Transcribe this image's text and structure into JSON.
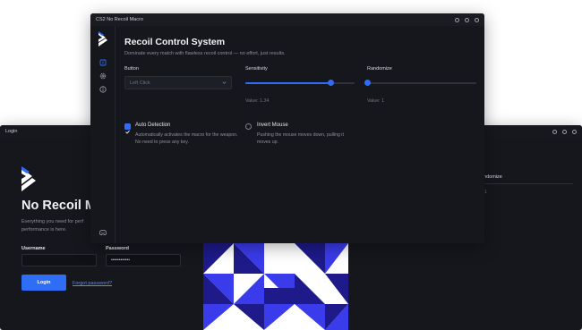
{
  "login_window": {
    "title": "Login",
    "heading": "No Recoil M",
    "subtitle": "Everything you need for perf... performance is here.",
    "subtitle_line1": "Everything you need for perf",
    "subtitle_line2": "performance is here.",
    "username_label": "Username",
    "username_value": "",
    "password_label": "Password",
    "password_value": "••••••••••••",
    "login_button": "Login",
    "forgot_link": "Forgot password?",
    "ghost_label": "andomize",
    "ghost_value": "e 1"
  },
  "main_window": {
    "title": "CS2 No Recoil Macro",
    "heading": "Recoil Control System",
    "subtitle": "Dominate every match with flawless recoil control — no effort, just results.",
    "button": {
      "label": "Button",
      "value": "Left Click"
    },
    "sensitivity": {
      "label": "Sensitivity",
      "value_text": "Value: 1.34",
      "level": 0.78
    },
    "randomize": {
      "label": "Randomize",
      "value_text": "Value: 1",
      "level": 0.0
    },
    "auto_detection": {
      "title": "Auto Detection",
      "checked": true,
      "description": "Automatically activates the macro for the weapon. No need to press any key."
    },
    "invert_mouse": {
      "title": "Invert Mouse",
      "checked": false,
      "description": "Pushing the mouse moves down, pulling it moves up."
    }
  },
  "icons": [
    "logo-icon",
    "crosshair-icon",
    "gear-icon",
    "info-icon",
    "discord-icon",
    "chevron-down-icon",
    "minimize-icon",
    "maximize-icon",
    "close-icon"
  ],
  "colors": {
    "accent": "#2f6df6",
    "window_bg": "#15171d",
    "pattern_dark": "#1e1a8a",
    "pattern_blue": "#3a3bea"
  }
}
